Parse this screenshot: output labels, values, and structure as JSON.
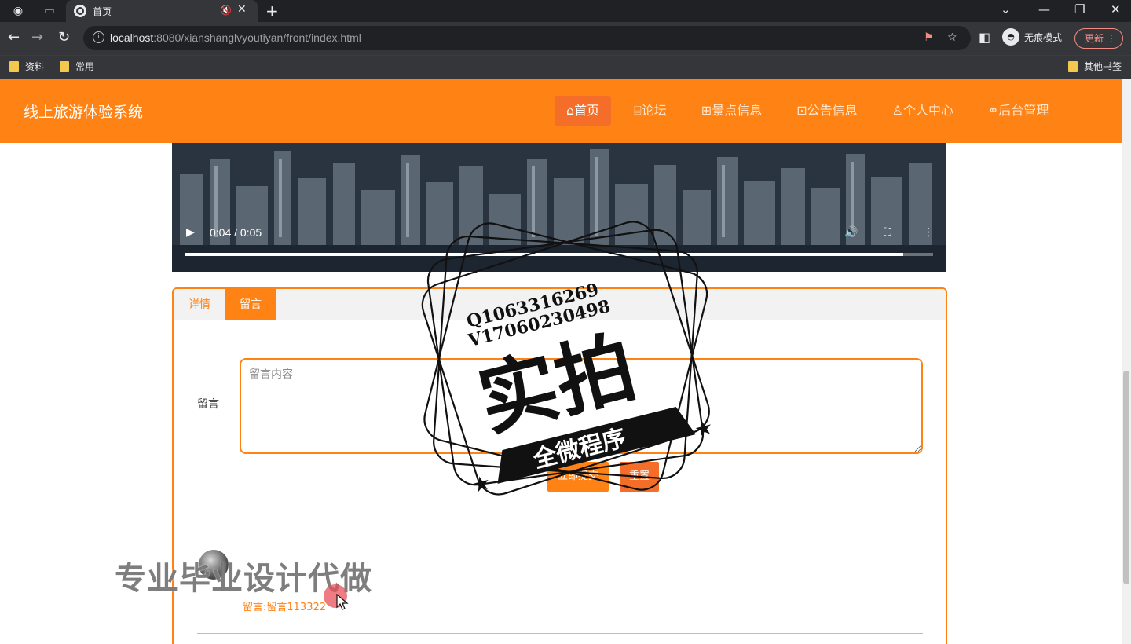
{
  "browser": {
    "tab_title": "首页",
    "url_host": "localhost",
    "url_rest": ":8080/xianshanglvyoutiyan/front/index.html",
    "profile_label": "无痕模式",
    "update_label": "更新",
    "bookmarks": [
      "资料",
      "常用"
    ],
    "other_bookmarks": "其他书签"
  },
  "site": {
    "title": "线上旅游体验系统",
    "nav": [
      {
        "label": "首页",
        "icon": "home-icon"
      },
      {
        "label": "论坛",
        "icon": "chat-icon"
      },
      {
        "label": "景点信息",
        "icon": "grid-icon"
      },
      {
        "label": "公告信息",
        "icon": "notice-icon"
      },
      {
        "label": "个人中心",
        "icon": "user-icon"
      },
      {
        "label": "后台管理",
        "icon": "link-icon"
      }
    ],
    "active_nav": 0
  },
  "video": {
    "time": "0:04 / 0:05",
    "progress": 0.96
  },
  "tabs": {
    "detail": "详情",
    "comment": "留言",
    "active": "comment"
  },
  "form": {
    "label": "留言",
    "placeholder": "留言内容",
    "submit": "立即提交",
    "reset": "重置"
  },
  "comments": [
    {
      "text": "留言:留言113322"
    }
  ],
  "overlays": {
    "stamp_big": "实拍",
    "stamp_banner": "全微程序",
    "stamp_line1": "Q1063316269",
    "stamp_line2": "V17060230498",
    "watermark": "专业毕业设计代做"
  },
  "colors": {
    "accent": "#ff8214",
    "active_nav": "#f46e2a"
  }
}
